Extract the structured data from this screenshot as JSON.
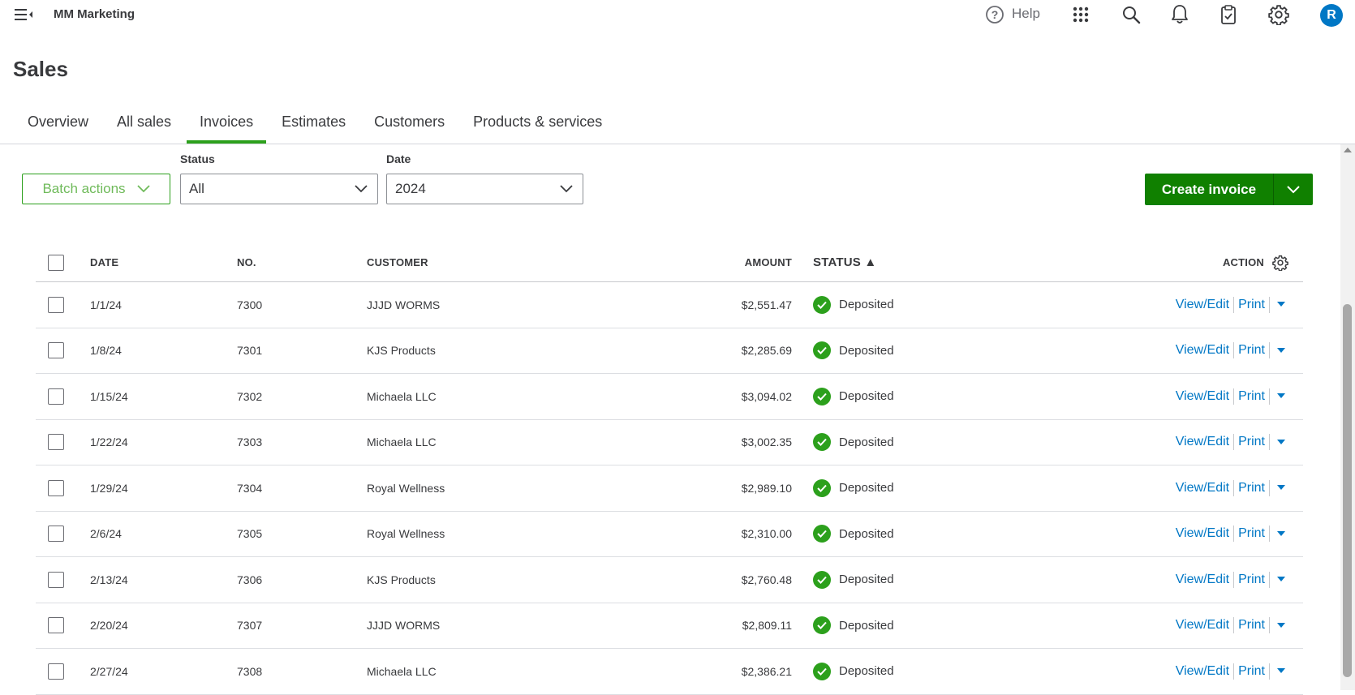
{
  "app": {
    "company": "MM Marketing"
  },
  "topbar": {
    "help_label": "Help",
    "avatar_initial": "R"
  },
  "page": {
    "title": "Sales"
  },
  "tabs": [
    {
      "label": "Overview"
    },
    {
      "label": "All sales"
    },
    {
      "label": "Invoices",
      "active": true
    },
    {
      "label": "Estimates"
    },
    {
      "label": "Customers"
    },
    {
      "label": "Products & services"
    }
  ],
  "filters": {
    "batch_label": "Batch actions",
    "status_label": "Status",
    "status_value": "All",
    "date_label": "Date",
    "date_value": "2024",
    "create_label": "Create invoice"
  },
  "table": {
    "headers": {
      "date": "DATE",
      "no": "NO.",
      "customer": "CUSTOMER",
      "amount": "AMOUNT",
      "status": "STATUS ▲",
      "action": "ACTION"
    },
    "action_view": "View/Edit",
    "action_print": "Print",
    "rows": [
      {
        "date": "1/1/24",
        "no": "7300",
        "customer": "JJJD WORMS",
        "amount": "$2,551.47",
        "status": "Deposited"
      },
      {
        "date": "1/8/24",
        "no": "7301",
        "customer": "KJS Products",
        "amount": "$2,285.69",
        "status": "Deposited"
      },
      {
        "date": "1/15/24",
        "no": "7302",
        "customer": "Michaela LLC",
        "amount": "$3,094.02",
        "status": "Deposited"
      },
      {
        "date": "1/22/24",
        "no": "7303",
        "customer": "Michaela LLC",
        "amount": "$3,002.35",
        "status": "Deposited"
      },
      {
        "date": "1/29/24",
        "no": "7304",
        "customer": "Royal Wellness",
        "amount": "$2,989.10",
        "status": "Deposited"
      },
      {
        "date": "2/6/24",
        "no": "7305",
        "customer": "Royal Wellness",
        "amount": "$2,310.00",
        "status": "Deposited"
      },
      {
        "date": "2/13/24",
        "no": "7306",
        "customer": "KJS Products",
        "amount": "$2,760.48",
        "status": "Deposited"
      },
      {
        "date": "2/20/24",
        "no": "7307",
        "customer": "JJJD WORMS",
        "amount": "$2,809.11",
        "status": "Deposited"
      },
      {
        "date": "2/27/24",
        "no": "7308",
        "customer": "Michaela LLC",
        "amount": "$2,386.21",
        "status": "Deposited"
      }
    ]
  },
  "colors": {
    "accent_green": "#2ca01c",
    "button_green": "#108000",
    "link_blue": "#0077c5"
  },
  "icons": [
    "menu-collapse-icon",
    "help-icon",
    "apps-grid-icon",
    "search-icon",
    "bell-icon",
    "clipboard-icon",
    "gear-icon",
    "chevron-down-icon",
    "checkmark-icon",
    "caret-down-icon"
  ]
}
